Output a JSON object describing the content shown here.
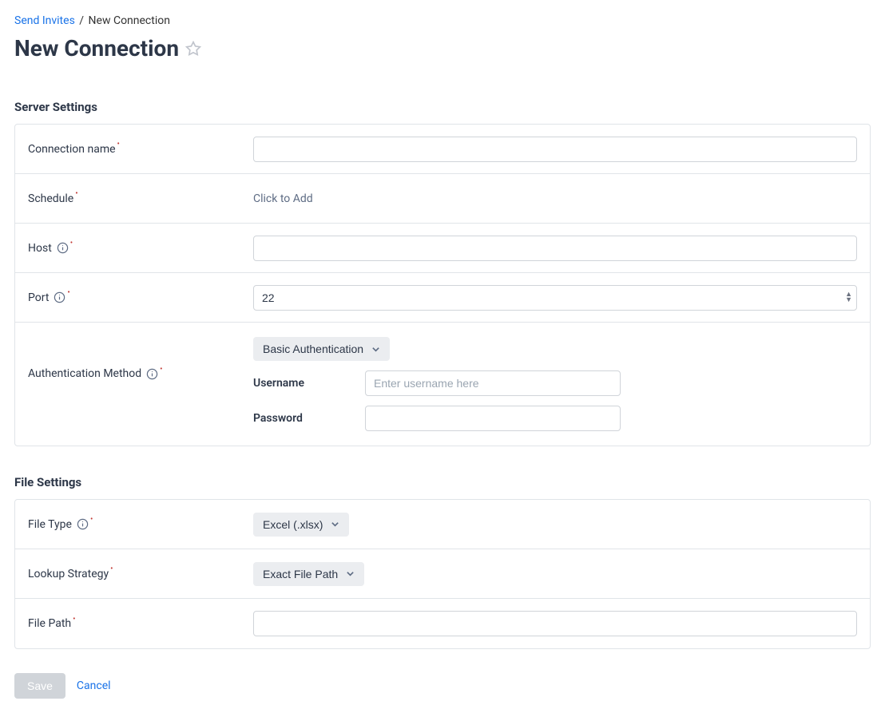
{
  "breadcrumb": {
    "parent": "Send Invites",
    "current": "New Connection"
  },
  "page_title": "New Connection",
  "sections": {
    "server": {
      "title": "Server Settings",
      "connection_name_label": "Connection name",
      "connection_name_value": "",
      "schedule_label": "Schedule",
      "schedule_placeholder": "Click to Add",
      "host_label": "Host",
      "host_value": "",
      "port_label": "Port",
      "port_value": "22",
      "auth_method_label": "Authentication Method",
      "auth_method_value": "Basic Authentication",
      "username_label": "Username",
      "username_placeholder": "Enter username here",
      "username_value": "",
      "password_label": "Password",
      "password_value": ""
    },
    "file": {
      "title": "File Settings",
      "file_type_label": "File Type",
      "file_type_value": "Excel (.xlsx)",
      "lookup_label": "Lookup Strategy",
      "lookup_value": "Exact File Path",
      "file_path_label": "File Path",
      "file_path_value": ""
    }
  },
  "actions": {
    "save": "Save",
    "cancel": "Cancel"
  }
}
